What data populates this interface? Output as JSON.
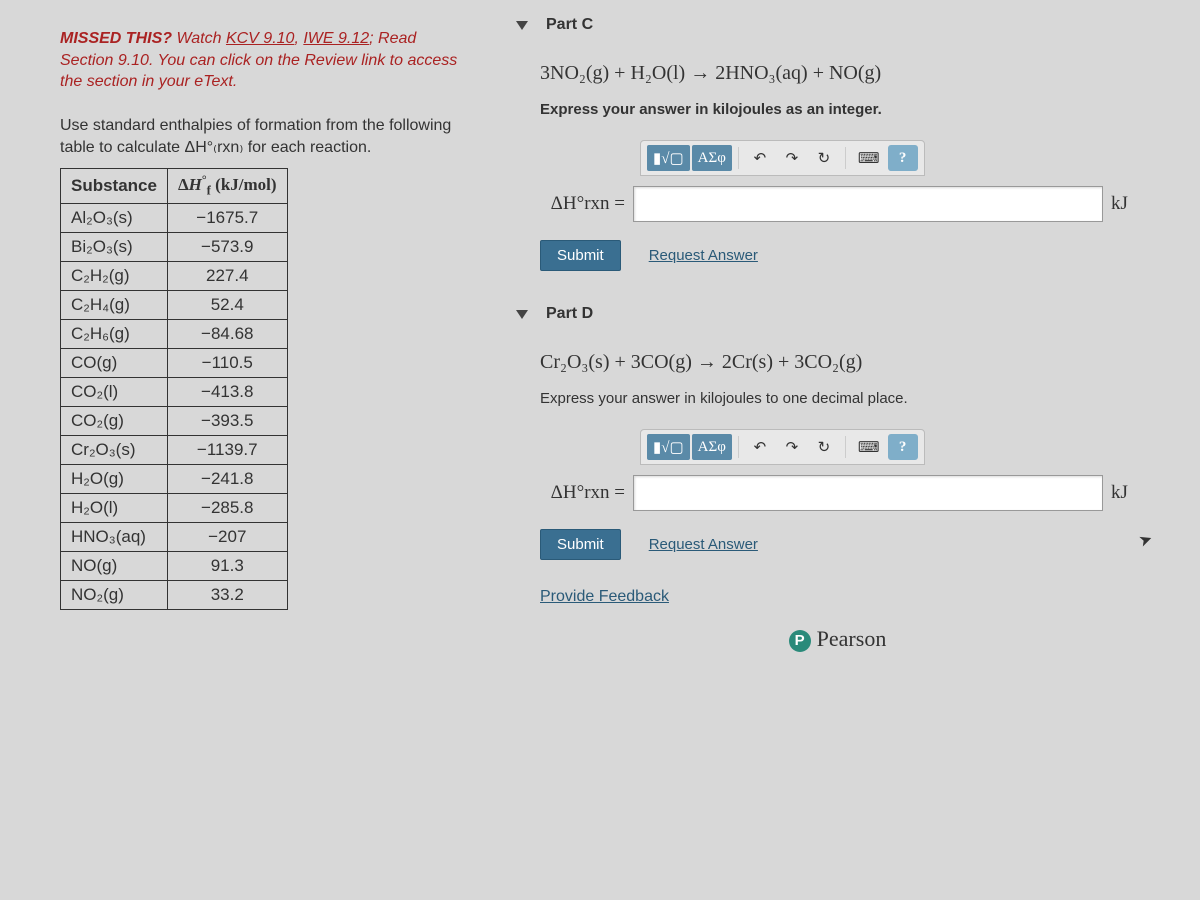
{
  "left": {
    "missed_prefix": "MISSED THIS? ",
    "missed_watch": "Watch ",
    "missed_link1": "KCV 9.10",
    "missed_sep": ", ",
    "missed_link2": "IWE 9.12",
    "missed_rest": "; Read Section 9.10. You can click on the Review link to access the section in your eText.",
    "intro": "Use standard enthalpies of formation from the following table to calculate ΔH°₍rxn₎ for each reaction.",
    "table_header_sub": "Substance",
    "table_header_val": "ΔH°f (kJ/mol)",
    "rows": [
      {
        "s": "Al₂O₃(s)",
        "v": "−1675.7"
      },
      {
        "s": "Bi₂O₃(s)",
        "v": "−573.9"
      },
      {
        "s": "C₂H₂(g)",
        "v": "227.4"
      },
      {
        "s": "C₂H₄(g)",
        "v": "52.4"
      },
      {
        "s": "C₂H₆(g)",
        "v": "−84.68"
      },
      {
        "s": "CO(g)",
        "v": "−110.5"
      },
      {
        "s": "CO₂(l)",
        "v": "−413.8"
      },
      {
        "s": "CO₂(g)",
        "v": "−393.5"
      },
      {
        "s": "Cr₂O₃(s)",
        "v": "−1139.7"
      },
      {
        "s": "H₂O(g)",
        "v": "−241.8"
      },
      {
        "s": "H₂O(l)",
        "v": "−285.8"
      },
      {
        "s": "HNO₃(aq)",
        "v": "−207"
      },
      {
        "s": "NO(g)",
        "v": "91.3"
      },
      {
        "s": "NO₂(g)",
        "v": "33.2"
      }
    ]
  },
  "partC": {
    "title": "Part C",
    "reaction": "3NO₂(g) + H₂O(l) → 2HNO₃(aq) + NO(g)",
    "prompt": "Express your answer in kilojoules as an integer.",
    "lhs": "ΔH°rxn =",
    "unit": "kJ",
    "submit": "Submit",
    "request": "Request Answer"
  },
  "partD": {
    "title": "Part D",
    "reaction": "Cr₂O₃(s) + 3CO(g) → 2Cr(s) + 3CO₂(g)",
    "prompt": "Express your answer in kilojoules to one decimal place.",
    "lhs": "ΔH°rxn =",
    "unit": "kJ",
    "submit": "Submit",
    "request": "Request Answer"
  },
  "toolbar": {
    "templates_icon": "▮√▢",
    "symbols": "ΑΣφ",
    "undo": "↶",
    "redo": "↷",
    "reset": "↻",
    "keyboard": "⌨",
    "help": "?"
  },
  "footer": {
    "feedback": "Provide Feedback",
    "pearson": "Pearson"
  }
}
